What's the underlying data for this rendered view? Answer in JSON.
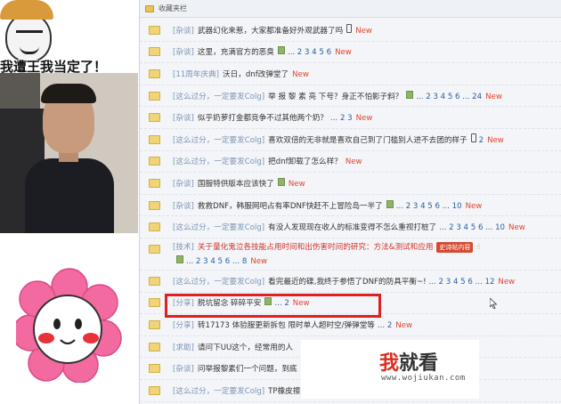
{
  "meme": {
    "caption": "我遭王我当定了！"
  },
  "favorites": {
    "label": "收藏夹栏"
  },
  "threads": [
    {
      "tag": "[杂谈]",
      "title": "武器幻化来惹，大家都准备好外观武器了吗",
      "pages": "",
      "new": "New",
      "attach": false,
      "phone": true
    },
    {
      "tag": "[杂谈]",
      "title": "这里，充满官方的恶臭",
      "pages": "... 2 3 4 5 6",
      "new": "New",
      "attach": true,
      "phone": false
    },
    {
      "tag": "[11周年庆典]",
      "title": "沃日，dnf改弹堂了",
      "pages": "",
      "new": "New",
      "attach": false,
      "phone": false
    },
    {
      "tag": "[这么过分，一定要发Colg]",
      "title": "举 报 黎 素 亮 下号？身正不怕影子斜？",
      "pages": "... 2 3 4 5 6 ... 24",
      "new": "New",
      "attach": true,
      "phone": false
    },
    {
      "tag": "[杂谈]",
      "title": "似乎奶萝打金都竞争不过其他两个奶？",
      "pages": "... 2 3",
      "new": "New",
      "attach": false,
      "phone": false
    },
    {
      "tag": "[这么过分，一定要发Colg]",
      "title": "喜欢双倍的无非就是喜欢自己到了门槛别人进不去团的样子",
      "pages": "2",
      "new": "New",
      "attach": false,
      "phone": true
    },
    {
      "tag": "[这么过分，一定要发Colg]",
      "title": "把dnf卸载了怎么样？",
      "pages": "",
      "new": "New",
      "attach": false,
      "phone": false
    },
    {
      "tag": "[杂谈]",
      "title": "国服特供版本应该快了",
      "pages": "",
      "new": "New",
      "attach": true,
      "phone": false
    },
    {
      "tag": "[杂谈]",
      "title": "救救DNF，韩服网吧占有率DNF快赶不上冒险岛一半了",
      "pages": "... 2 3 4 5 6 ... 10",
      "new": "New",
      "attach": true,
      "phone": false
    },
    {
      "tag": "[这么过分，一定要发Colg]",
      "title": "有没人发现现在收人的标准变得不怎么重视打桩了",
      "pages": "... 2 3 4 5 6 ... 10",
      "new": "New",
      "attach": false,
      "phone": false
    },
    {
      "tag": "[技术]",
      "title": "关于量化鬼泣各技能占用时间和出伤害时间的研究：方法&测试和应用",
      "badge": "史诗帖内容",
      "pages": "... 2 3 4 5 6 ... 8",
      "new": "New",
      "attach": true,
      "phone": false,
      "tall": true,
      "red": true
    },
    {
      "tag": "[这么过分，一定要发Colg]",
      "title": "看完最近的碟,我终于参悟了DNF的防具平衡~!",
      "pages": "... 2 3 4 5 6 ... 12",
      "new": "New",
      "attach": false,
      "phone": false
    },
    {
      "tag": "[分享]",
      "title": "脱坑留念 碎碎平安",
      "pages": "... 2",
      "new": "New",
      "attach": true,
      "phone": false
    },
    {
      "tag": "[分享]",
      "title": "转17173 体验服更新拆包 限时单人超时空/弹弹堂等",
      "pages": "... 2",
      "new": "New",
      "attach": false,
      "phone": false
    },
    {
      "tag": "[求助]",
      "title": "请问下UU这个，经常用的人",
      "pages": "",
      "new": "",
      "attach": false,
      "phone": false
    },
    {
      "tag": "[杂谈]",
      "title": "问举报黎素们一个问题，到底",
      "pages": "",
      "new": "",
      "attach": false,
      "phone": false
    },
    {
      "tag": "[这么过分，一定要发Colg]",
      "title": "TP橡皮擦",
      "pages": "",
      "new": "",
      "attach": false,
      "phone": false
    }
  ],
  "watermark": {
    "brand_red": "我",
    "brand_rest": "就看",
    "url": "www.wojiukan.com"
  },
  "colors": {
    "tag": "#7b94b6",
    "new": "#e0452f",
    "highlight": "#e0201f",
    "link": "#2b5fa3"
  }
}
